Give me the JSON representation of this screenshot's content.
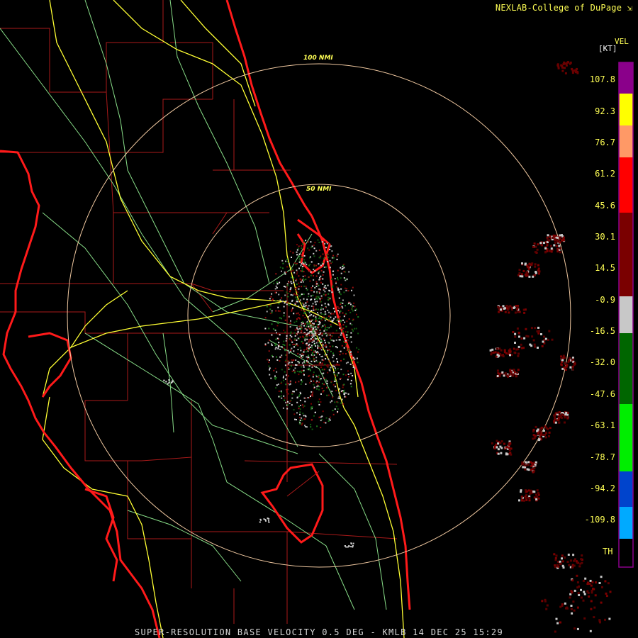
{
  "credit": "NEXLAB-College of DuPage",
  "footer": "SUPER-RESOLUTION BASE VELOCITY 0.5 DEG - KMLB 14 DEC 25 15:29",
  "legend": {
    "product": "VEL",
    "unit": "[KT]",
    "labels": [
      "107.8",
      "92.3",
      "76.7",
      "61.2",
      "45.6",
      "30.1",
      "14.5",
      "-0.9",
      "-16.5",
      "-32.0",
      "-47.6",
      "-63.1",
      "-78.7",
      "-94.2",
      "-109.8"
    ],
    "th_label": "TH",
    "colors": {
      "purple": "#8a008a",
      "yellow": "#ffff00",
      "orange": "#ff9966",
      "red": "#ff0000",
      "darkred": "#7a0000",
      "gray": "#c8c8c8",
      "darkgreen": "#006600",
      "green": "#00ee00",
      "blue": "#0044cc",
      "cyan": "#00aaff",
      "black": "#000000"
    }
  },
  "range_rings": [
    {
      "label": "100 NMI"
    },
    {
      "label": "50 NMI"
    }
  ],
  "map_colors": {
    "coastline": "#ff1a1a",
    "county": "#aa1a1a",
    "highway": "#ffff33",
    "road": "#88dd88",
    "ring": "#f0c8a0"
  }
}
